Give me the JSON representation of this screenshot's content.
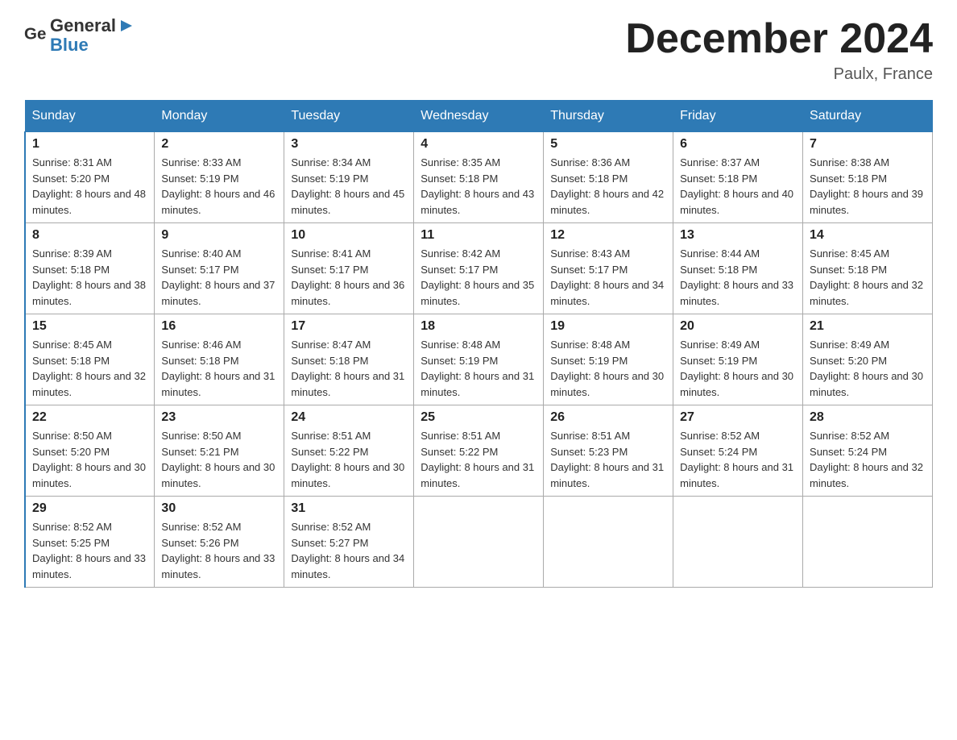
{
  "header": {
    "logo_general": "General",
    "logo_blue": "Blue",
    "title": "December 2024",
    "location": "Paulx, France"
  },
  "weekdays": [
    "Sunday",
    "Monday",
    "Tuesday",
    "Wednesday",
    "Thursday",
    "Friday",
    "Saturday"
  ],
  "weeks": [
    [
      {
        "day": "1",
        "sunrise": "8:31 AM",
        "sunset": "5:20 PM",
        "daylight": "8 hours and 48 minutes."
      },
      {
        "day": "2",
        "sunrise": "8:33 AM",
        "sunset": "5:19 PM",
        "daylight": "8 hours and 46 minutes."
      },
      {
        "day": "3",
        "sunrise": "8:34 AM",
        "sunset": "5:19 PM",
        "daylight": "8 hours and 45 minutes."
      },
      {
        "day": "4",
        "sunrise": "8:35 AM",
        "sunset": "5:18 PM",
        "daylight": "8 hours and 43 minutes."
      },
      {
        "day": "5",
        "sunrise": "8:36 AM",
        "sunset": "5:18 PM",
        "daylight": "8 hours and 42 minutes."
      },
      {
        "day": "6",
        "sunrise": "8:37 AM",
        "sunset": "5:18 PM",
        "daylight": "8 hours and 40 minutes."
      },
      {
        "day": "7",
        "sunrise": "8:38 AM",
        "sunset": "5:18 PM",
        "daylight": "8 hours and 39 minutes."
      }
    ],
    [
      {
        "day": "8",
        "sunrise": "8:39 AM",
        "sunset": "5:18 PM",
        "daylight": "8 hours and 38 minutes."
      },
      {
        "day": "9",
        "sunrise": "8:40 AM",
        "sunset": "5:17 PM",
        "daylight": "8 hours and 37 minutes."
      },
      {
        "day": "10",
        "sunrise": "8:41 AM",
        "sunset": "5:17 PM",
        "daylight": "8 hours and 36 minutes."
      },
      {
        "day": "11",
        "sunrise": "8:42 AM",
        "sunset": "5:17 PM",
        "daylight": "8 hours and 35 minutes."
      },
      {
        "day": "12",
        "sunrise": "8:43 AM",
        "sunset": "5:17 PM",
        "daylight": "8 hours and 34 minutes."
      },
      {
        "day": "13",
        "sunrise": "8:44 AM",
        "sunset": "5:18 PM",
        "daylight": "8 hours and 33 minutes."
      },
      {
        "day": "14",
        "sunrise": "8:45 AM",
        "sunset": "5:18 PM",
        "daylight": "8 hours and 32 minutes."
      }
    ],
    [
      {
        "day": "15",
        "sunrise": "8:45 AM",
        "sunset": "5:18 PM",
        "daylight": "8 hours and 32 minutes."
      },
      {
        "day": "16",
        "sunrise": "8:46 AM",
        "sunset": "5:18 PM",
        "daylight": "8 hours and 31 minutes."
      },
      {
        "day": "17",
        "sunrise": "8:47 AM",
        "sunset": "5:18 PM",
        "daylight": "8 hours and 31 minutes."
      },
      {
        "day": "18",
        "sunrise": "8:48 AM",
        "sunset": "5:19 PM",
        "daylight": "8 hours and 31 minutes."
      },
      {
        "day": "19",
        "sunrise": "8:48 AM",
        "sunset": "5:19 PM",
        "daylight": "8 hours and 30 minutes."
      },
      {
        "day": "20",
        "sunrise": "8:49 AM",
        "sunset": "5:19 PM",
        "daylight": "8 hours and 30 minutes."
      },
      {
        "day": "21",
        "sunrise": "8:49 AM",
        "sunset": "5:20 PM",
        "daylight": "8 hours and 30 minutes."
      }
    ],
    [
      {
        "day": "22",
        "sunrise": "8:50 AM",
        "sunset": "5:20 PM",
        "daylight": "8 hours and 30 minutes."
      },
      {
        "day": "23",
        "sunrise": "8:50 AM",
        "sunset": "5:21 PM",
        "daylight": "8 hours and 30 minutes."
      },
      {
        "day": "24",
        "sunrise": "8:51 AM",
        "sunset": "5:22 PM",
        "daylight": "8 hours and 30 minutes."
      },
      {
        "day": "25",
        "sunrise": "8:51 AM",
        "sunset": "5:22 PM",
        "daylight": "8 hours and 31 minutes."
      },
      {
        "day": "26",
        "sunrise": "8:51 AM",
        "sunset": "5:23 PM",
        "daylight": "8 hours and 31 minutes."
      },
      {
        "day": "27",
        "sunrise": "8:52 AM",
        "sunset": "5:24 PM",
        "daylight": "8 hours and 31 minutes."
      },
      {
        "day": "28",
        "sunrise": "8:52 AM",
        "sunset": "5:24 PM",
        "daylight": "8 hours and 32 minutes."
      }
    ],
    [
      {
        "day": "29",
        "sunrise": "8:52 AM",
        "sunset": "5:25 PM",
        "daylight": "8 hours and 33 minutes."
      },
      {
        "day": "30",
        "sunrise": "8:52 AM",
        "sunset": "5:26 PM",
        "daylight": "8 hours and 33 minutes."
      },
      {
        "day": "31",
        "sunrise": "8:52 AM",
        "sunset": "5:27 PM",
        "daylight": "8 hours and 34 minutes."
      },
      {
        "day": "",
        "sunrise": "",
        "sunset": "",
        "daylight": ""
      },
      {
        "day": "",
        "sunrise": "",
        "sunset": "",
        "daylight": ""
      },
      {
        "day": "",
        "sunrise": "",
        "sunset": "",
        "daylight": ""
      },
      {
        "day": "",
        "sunrise": "",
        "sunset": "",
        "daylight": ""
      }
    ]
  ],
  "labels": {
    "sunrise_prefix": "Sunrise: ",
    "sunset_prefix": "Sunset: ",
    "daylight_prefix": "Daylight: "
  }
}
